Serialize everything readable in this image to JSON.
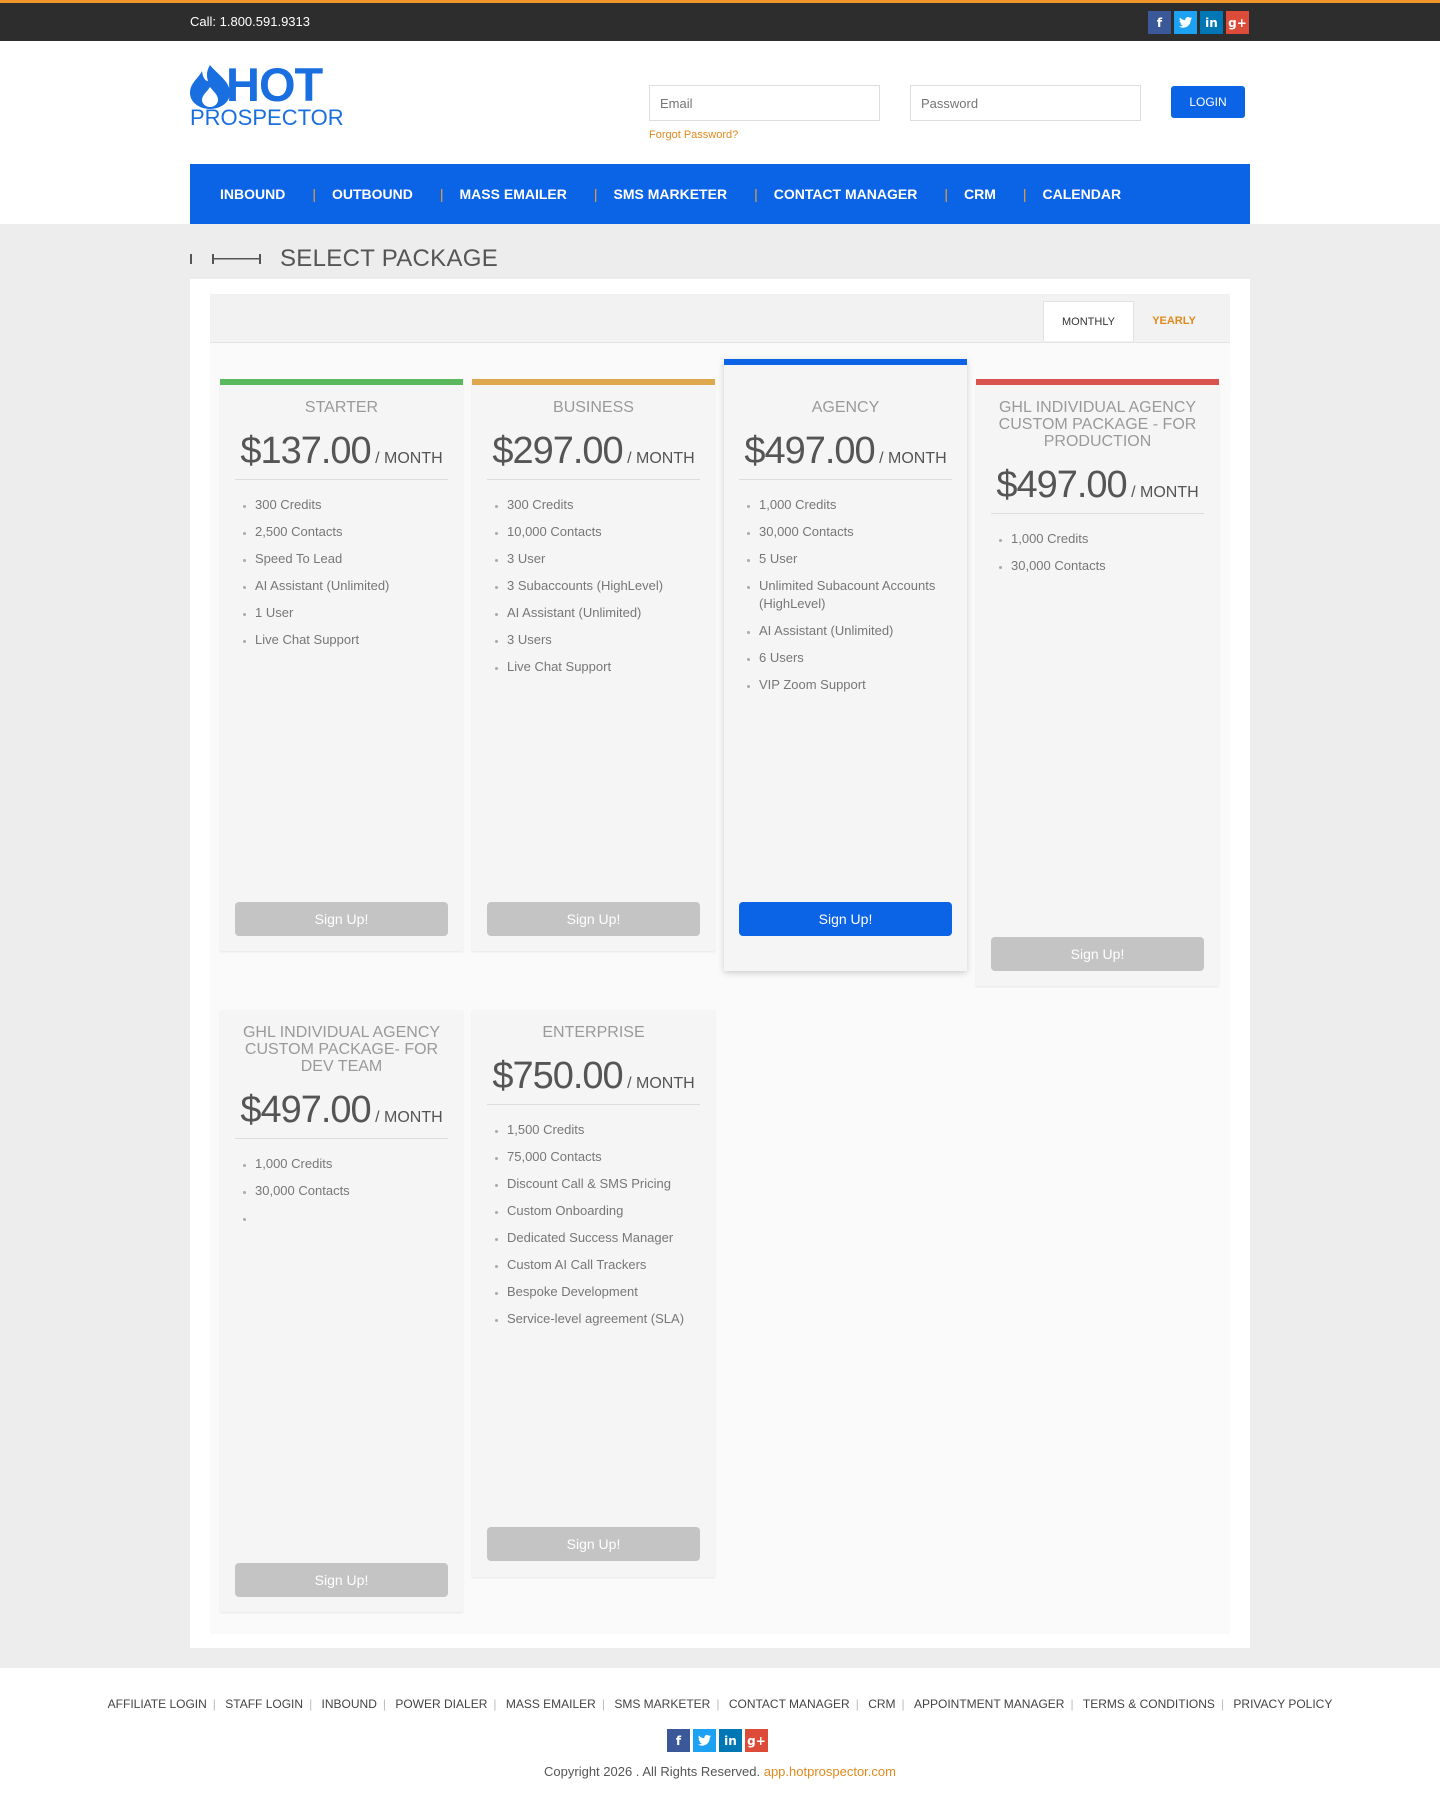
{
  "topbar": {
    "call": "Call: 1.800.591.9313",
    "social": [
      "facebook-icon",
      "twitter-icon",
      "linkedin-icon",
      "google-plus-icon"
    ]
  },
  "header": {
    "logo_top": "HOT",
    "logo_bottom": "PROSPECTOR",
    "email_placeholder": "Email",
    "password_placeholder": "Password",
    "forgot": "Forgot Password?",
    "login": "LOGIN"
  },
  "nav": [
    "INBOUND",
    "OUTBOUND",
    "MASS EMAILER",
    "SMS MARKETER",
    "CONTACT MANAGER",
    "CRM",
    "CALENDAR"
  ],
  "page_title": "SELECT PACKAGE",
  "tabs": {
    "monthly": "MONTHLY",
    "yearly": "YEARLY"
  },
  "colors": {
    "accent": "#0b63e5",
    "orange": "#e08a1e",
    "starter": "#5cb85c",
    "business": "#e0a84c",
    "agency": "#0b63e5",
    "ghl": "#d9534f"
  },
  "packages": [
    {
      "name": "STARTER",
      "price": "$137.00",
      "per": "/ MONTH",
      "features": [
        "300 Credits",
        "2,500 Contacts",
        "Speed To Lead",
        "AI Assistant (Unlimited)",
        "1 User",
        "Live Chat Support"
      ],
      "button": "Sign Up!"
    },
    {
      "name": "BUSINESS",
      "price": "$297.00",
      "per": "/ MONTH",
      "features": [
        "300 Credits",
        "10,000 Contacts",
        "3 User",
        "3 Subaccounts (HighLevel)",
        "AI Assistant (Unlimited)",
        "3 Users",
        "Live Chat Support"
      ],
      "button": "Sign Up!"
    },
    {
      "name": "AGENCY",
      "price": "$497.00",
      "per": "/ MONTH",
      "features": [
        "1,000 Credits",
        "30,000 Contacts",
        "5 User",
        "Unlimited Subacount Accounts (HighLevel)",
        "AI Assistant (Unlimited)",
        "6 Users",
        "VIP Zoom Support"
      ],
      "button": "Sign Up!"
    },
    {
      "name": "GHL INDIVIDUAL AGENCY CUSTOM PACKAGE - FOR PRODUCTION",
      "price": "$497.00",
      "per": "/ MONTH",
      "features": [
        "1,000 Credits",
        "30,000 Contacts"
      ],
      "button": "Sign Up!"
    },
    {
      "name": "GHL INDIVIDUAL AGENCY CUSTOM PACKAGE- FOR DEV TEAM",
      "price": "$497.00",
      "per": "/ MONTH",
      "features": [
        "1,000 Credits",
        "30,000 Contacts",
        ""
      ],
      "button": "Sign Up!"
    },
    {
      "name": "ENTERPRISE",
      "price": "$750.00",
      "per": "/ MONTH",
      "features": [
        "1,500 Credits",
        "75,000 Contacts",
        "Discount Call & SMS Pricing",
        "Custom Onboarding",
        "Dedicated Success Manager",
        "Custom AI Call Trackers",
        "Bespoke Development",
        "Service-level agreement (SLA)"
      ],
      "button": "Sign Up!"
    }
  ],
  "footer": {
    "links": [
      "AFFILIATE LOGIN",
      "STAFF LOGIN",
      "INBOUND",
      "POWER DIALER",
      "MASS EMAILER",
      "SMS MARKETER",
      "CONTACT MANAGER",
      "CRM",
      "APPOINTMENT MANAGER",
      "TERMS & CONDITIONS",
      "PRIVACY POLICY"
    ],
    "copyright": "Copyright 2026 . All Rights Reserved.",
    "site": "app.hotprospector.com"
  }
}
